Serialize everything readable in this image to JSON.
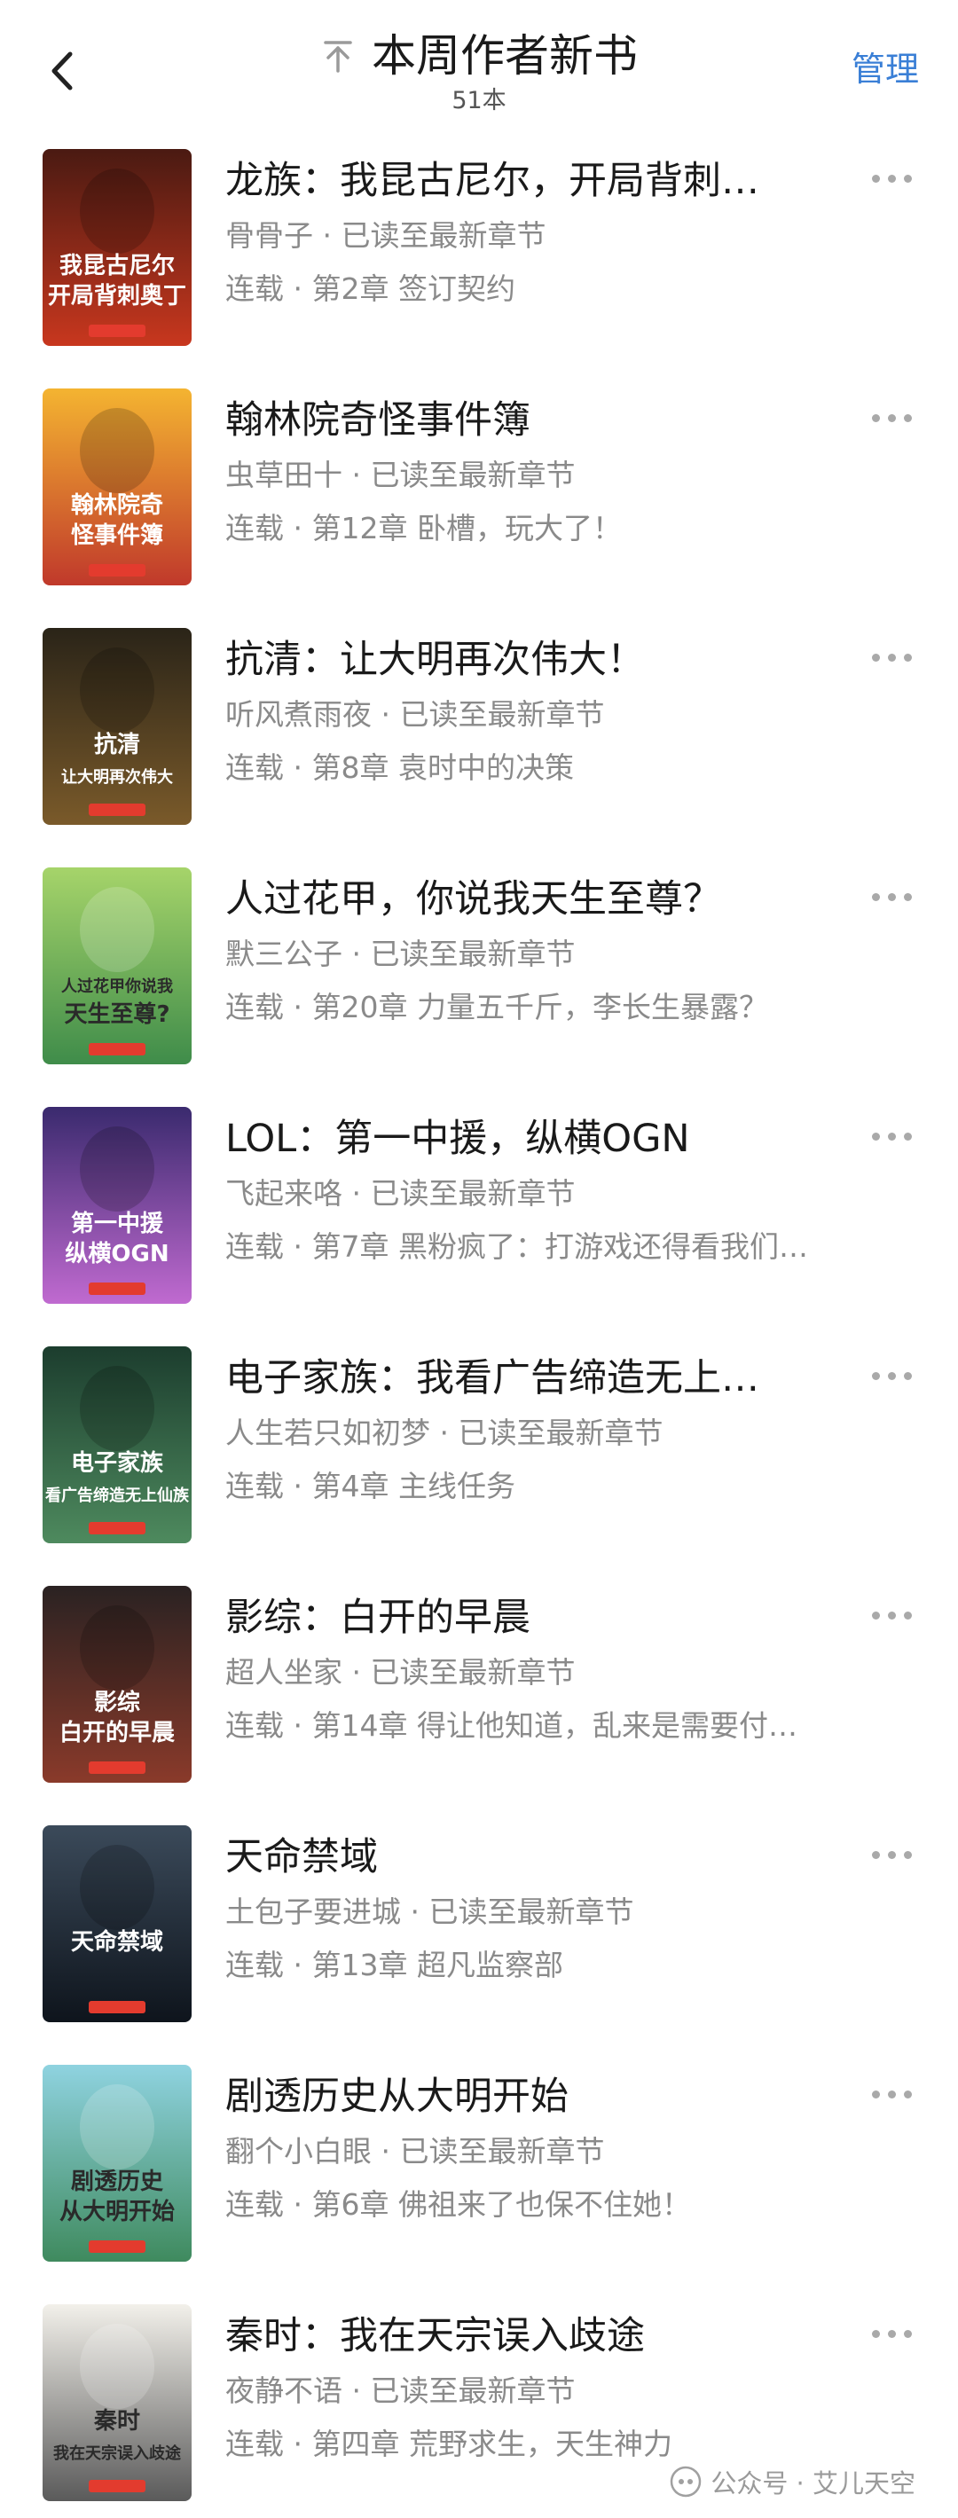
{
  "header": {
    "title": "本周作者新书",
    "count": "51本",
    "manage_label": "管理",
    "back_icon": "chevron-left-icon",
    "pin_icon": "pin-to-top-icon"
  },
  "books": [
    {
      "title": "龙族：我昆古尼尔，开局背刺…",
      "meta": "骨骨子 · 已读至最新章节",
      "chapter": "连载 · 第2章 签订契约",
      "cover_text": "我昆古尼尔 开局背刺奥丁",
      "cover_colors": [
        "#4a1a12",
        "#c8371e"
      ]
    },
    {
      "title": "翰林院奇怪事件簿",
      "meta": "虫草田十 · 已读至最新章节",
      "chapter": "连载 · 第12章 卧槽，玩大了！",
      "cover_text": "翰林院奇 怪事件簿",
      "cover_colors": [
        "#f4b431",
        "#c0392b"
      ]
    },
    {
      "title": "抗清：让大明再次伟大！",
      "meta": "听风煮雨夜 · 已读至最新章节",
      "chapter": "连载 · 第8章 袁时中的决策",
      "cover_text": "抗清 让大明再次伟大",
      "cover_colors": [
        "#2a2418",
        "#7a5a2a"
      ]
    },
    {
      "title": "人过花甲，你说我天生至尊？",
      "meta": "默三公子 · 已读至最新章节",
      "chapter": "连载 · 第20章 力量五千斤，李长生暴露？",
      "cover_text": "人过花甲你说我 天生至尊?",
      "cover_colors": [
        "#a6d46a",
        "#3f8c4a"
      ]
    },
    {
      "title": "LOL：第一中援，纵横OGN",
      "meta": "飞起来咯 · 已读至最新章节",
      "chapter": "连载 · 第7章 黑粉疯了：打游戏还得看我们…",
      "cover_text": "第一中援 纵横OGN",
      "cover_colors": [
        "#3a2a6e",
        "#c06ad0"
      ]
    },
    {
      "title": "电子家族：我看广告缔造无上…",
      "meta": "人生若只如初梦 · 已读至最新章节",
      "chapter": "连载 · 第4章 主线任务",
      "cover_text": "电子家族 看广告缔造无上仙族",
      "cover_colors": [
        "#1c3d2e",
        "#4e8a5e"
      ]
    },
    {
      "title": "影综：白开的早晨",
      "meta": "超人坐家 · 已读至最新章节",
      "chapter": "连载 · 第14章 得让他知道，乱来是需要付…",
      "cover_text": "影综 白开的早晨",
      "cover_colors": [
        "#2a2222",
        "#8a3a2a"
      ]
    },
    {
      "title": "天命禁域",
      "meta": "土包子要进城 · 已读至最新章节",
      "chapter": "连载 · 第13章 超凡监察部",
      "cover_text": "天命禁域",
      "cover_colors": [
        "#3b4a5a",
        "#0e141c"
      ]
    },
    {
      "title": "剧透历史从大明开始",
      "meta": "翻个小白眼 · 已读至最新章节",
      "chapter": "连载 · 第6章 佛祖来了也保不住她！",
      "cover_text": "剧透历史 从大明开始",
      "cover_colors": [
        "#8fd3e0",
        "#3f8a5e"
      ]
    },
    {
      "title": "秦时：我在天宗误入歧途",
      "meta": "夜静不语 · 已读至最新章节",
      "chapter": "连载 · 第四章 荒野求生，天生神力",
      "cover_text": "秦时 我在天宗误入歧途",
      "cover_colors": [
        "#f2f0ea",
        "#5a5a5a"
      ]
    }
  ],
  "watermark": {
    "text": "公众号 · 艾儿天空",
    "icon": "wechat-official-account-icon"
  }
}
